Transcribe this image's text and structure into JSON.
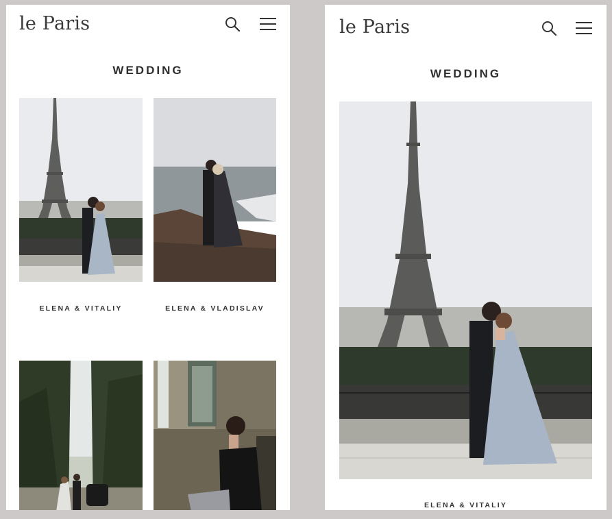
{
  "brand": {
    "logo_text": "le Paris"
  },
  "section": {
    "title": "WEDDING"
  },
  "left_view": {
    "items": [
      {
        "caption": "ELENA & VITALIY",
        "image": "eiffel-tower-couple-photo"
      },
      {
        "caption": "ELENA & VLADISLAV",
        "image": "seaside-cliff-couple-photo"
      },
      {
        "caption": "",
        "image": "cypress-avenue-couple-car-photo"
      },
      {
        "caption": "",
        "image": "woman-by-window-photo"
      }
    ]
  },
  "right_view": {
    "items": [
      {
        "caption": "ELENA & VITALIY",
        "image": "eiffel-tower-couple-photo"
      }
    ]
  },
  "icons": {
    "search": "search-icon",
    "menu": "hamburger-menu-icon"
  },
  "colors": {
    "background": "#cdc9c8",
    "panel": "#ffffff",
    "text": "#333333"
  }
}
